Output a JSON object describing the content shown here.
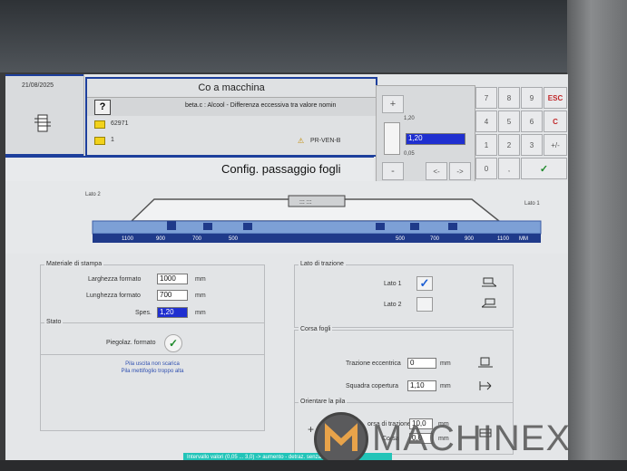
{
  "header": {
    "date": "21/08/2025",
    "title": "Co   a macchina",
    "help_label": "?",
    "message": "beta.c :  Alcool - Differenza eccessiva tra valore nomin",
    "job_number": "62971",
    "counter": "1",
    "station_code": "PR-VEN-B",
    "warning_symbol": "⚠",
    "page_title": "Config. passaggio fogli"
  },
  "adjuster": {
    "plus_label": "+",
    "minus_label": "-",
    "max_label": "1,20",
    "min_label": "0,05",
    "value": "1,20",
    "left_arrow": "<-",
    "right_arrow": "->"
  },
  "keypad": {
    "keys": [
      "7",
      "8",
      "9",
      "ESC",
      "4",
      "5",
      "6",
      "C",
      "1",
      "2",
      "3",
      "+/-",
      "0",
      ",",
      "✓"
    ]
  },
  "machine": {
    "lato2_label": "Lato 2",
    "lato1_label": "Lato 1",
    "scale_left": [
      "1100",
      "900",
      "700",
      "500"
    ],
    "scale_right": [
      "500",
      "700",
      "900",
      "1100",
      "MM"
    ]
  },
  "materiale": {
    "title": "Materiale di stampa",
    "larghezza_label": "Larghezza formato",
    "larghezza_value": "1000",
    "lunghezza_label": "Lunghezza formato",
    "lunghezza_value": "700",
    "spes_label": "Spes.",
    "spes_value": "1,20",
    "unit": "mm"
  },
  "stato": {
    "title": "Stato",
    "piegolaz_label": "Piegolaz. formato",
    "msg1": "Pila uscita non scarica",
    "msg2": "Pila mettifoglio troppo alta"
  },
  "lato_trazione": {
    "title": "Lato di trazione",
    "lato1": "Lato 1",
    "lato2": "Lato 2"
  },
  "corsa_fogli": {
    "title": "Corsa fogli",
    "trazione_label": "Trazione eccentrica",
    "trazione_value": "0",
    "squadra_label": "Squadra copertura",
    "squadra_value": "1,10",
    "unit": "mm"
  },
  "orientare": {
    "title": "Orientare la pila",
    "plus_label": "+",
    "corsa_label": "orsa di trazione",
    "corsa_value": "10,0",
    "second_label": "Corsa",
    "second_value": "0,0",
    "unit": "mm"
  },
  "status_bar": {
    "text": "Intervallo valori (0,05 ... 3,0) -> aumento - detraz. senza (0,01)"
  },
  "watermark": {
    "text": "MACHINEX"
  },
  "colors": {
    "accent_blue": "#1d3f9c",
    "selection_blue": "#1f2fd0",
    "status_teal": "#22c4b8",
    "warning_yellow": "#f2d21b",
    "green_check": "#1f8a2b"
  }
}
